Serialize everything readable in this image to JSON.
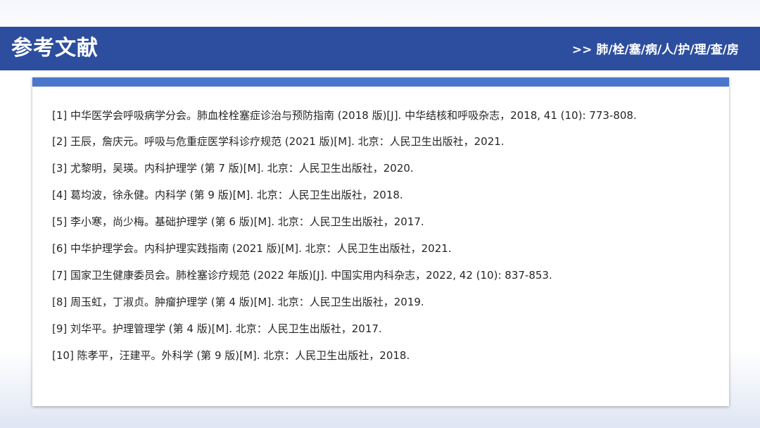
{
  "header": {
    "title": "参考文献",
    "subtitle": ">> 肺/栓/塞/病/人/护/理/查/房"
  },
  "references": [
    "[1] 中华医学会呼吸病学分会。肺血栓栓塞症诊治与预防指南 (2018 版)[J]. 中华结核和呼吸杂志，2018, 41 (10): 773-808.",
    "[2] 王辰，詹庆元。呼吸与危重症医学科诊疗规范 (2021 版)[M]. 北京：人民卫生出版社，2021.",
    "[3] 尤黎明，吴瑛。内科护理学 (第 7 版)[M]. 北京：人民卫生出版社，2020.",
    "[4] 葛均波，徐永健。内科学 (第 9 版)[M]. 北京：人民卫生出版社，2018.",
    "[5] 李小寒，尚少梅。基础护理学 (第 6 版)[M]. 北京：人民卫生出版社，2017.",
    "[6] 中华护理学会。内科护理实践指南 (2021 版)[M]. 北京：人民卫生出版社，2021.",
    "[7] 国家卫生健康委员会。肺栓塞诊疗规范 (2022 年版)[J]. 中国实用内科杂志，2022, 42 (10): 837-853.",
    "[8] 周玉虹，丁淑贞。肿瘤护理学 (第 4 版)[M]. 北京：人民卫生出版社，2019.",
    "[9] 刘华平。护理管理学 (第 4 版)[M]. 北京：人民卫生出版社，2017.",
    "[10] 陈孝平，汪建平。外科学 (第 9 版)[M]. 北京：人民卫生出版社，2018."
  ],
  "colors": {
    "header_bg": "#2d4e9e",
    "accent_strip": "#4a76cc",
    "text": "#262626"
  }
}
